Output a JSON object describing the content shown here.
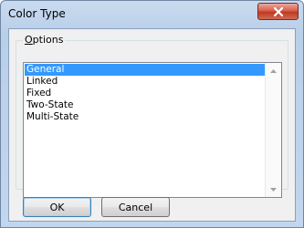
{
  "window": {
    "title": "Color Type",
    "close_icon": "close-icon"
  },
  "options": {
    "legend_accel": "O",
    "legend_rest": "ptions",
    "items": [
      {
        "label": "General",
        "selected": true
      },
      {
        "label": "Linked",
        "selected": false
      },
      {
        "label": "Fixed",
        "selected": false
      },
      {
        "label": "Two-State",
        "selected": false
      },
      {
        "label": "Multi-State",
        "selected": false
      }
    ]
  },
  "buttons": {
    "ok_label": "OK",
    "cancel_label": "Cancel"
  },
  "colors": {
    "selection": "#3399ff",
    "close_button": "#c0391f"
  }
}
